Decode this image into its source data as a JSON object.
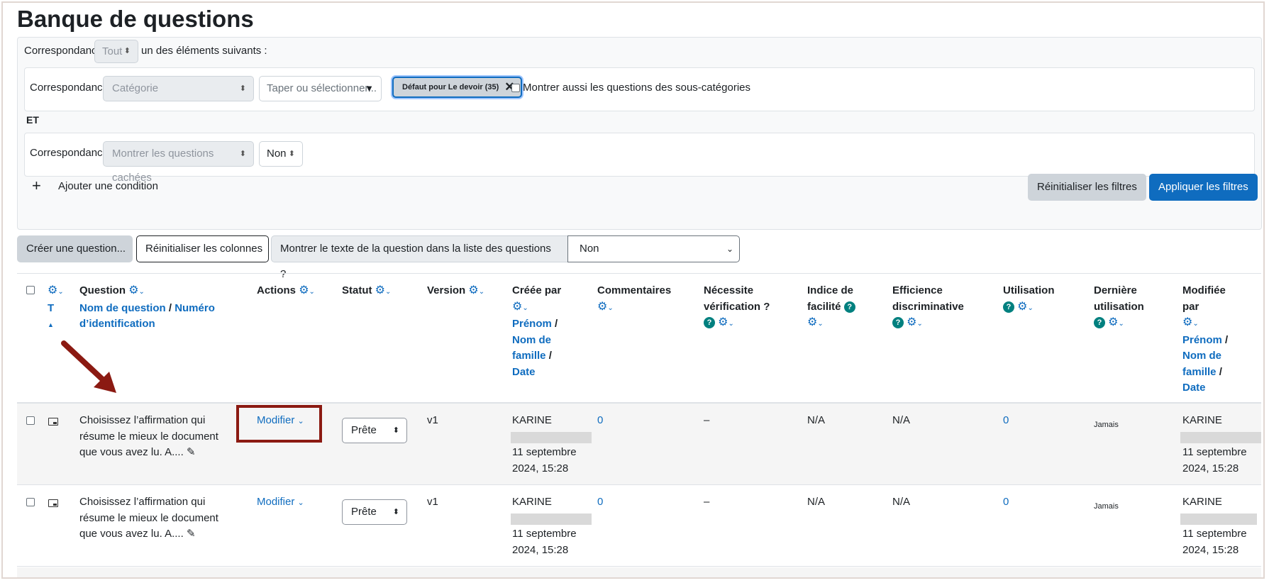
{
  "page_title": "Banque de questions",
  "filters": {
    "top_match_label": "Correspondance",
    "top_match_value": "Tout",
    "top_match_suffix": "un des éléments suivants :",
    "cond1": {
      "label": "Correspondance",
      "type_value": "Catégorie",
      "search_placeholder": "Taper ou sélectionner...",
      "chip_label": "Défaut pour Le devoir (35)",
      "chip_remove": "✕",
      "checkbox_label": "Montrer aussi les questions des sous-catégories"
    },
    "join_label": "ET",
    "cond2": {
      "label": "Correspondance",
      "type_value": "Montrer les questions cachées",
      "value": "Non"
    },
    "add_condition_icon": "+",
    "add_condition_label": "Ajouter une condition",
    "reset_label": "Réinitialiser les filtres",
    "apply_label": "Appliquer les filtres"
  },
  "toolbar": {
    "create_label": "Créer une question...",
    "reset_columns_label": "Réinitialiser les colonnes",
    "show_text_label": "Montrer le texte de la question dans la liste des questions ?",
    "show_text_value": "Non"
  },
  "table": {
    "headers": {
      "type": "T",
      "question": "Question",
      "question_name": "Nom de question",
      "question_sep": "/",
      "question_id_1": "Numéro",
      "question_id_2": "d’identification",
      "actions": "Actions",
      "status": "Statut",
      "version": "Version",
      "created_by": "Créée par",
      "firstname": "Prénom",
      "lastname_1": "Nom de",
      "lastname_2": "famille",
      "date": "Date",
      "comments": "Commentaires",
      "needs_check_1": "Nécessite",
      "needs_check_2": "vérification ?",
      "facility_1": "Indice de",
      "facility_2": "facilité",
      "discrim_1": "Efficience",
      "discrim_2": "discriminative",
      "usage": "Utilisation",
      "last_used_1": "Dernière",
      "last_used_2": "utilisation",
      "modified_by_1": "Modifiée",
      "modified_by_2": "par"
    },
    "rows": [
      {
        "question_1": "Choisissez l’affirmation qui",
        "question_2": "résume le mieux le document",
        "question_3": "que vous avez lu. A....",
        "action": "Modifier",
        "status": "Prête",
        "version": "v1",
        "created_name": "KARINE",
        "created_date_1": "11 septembre",
        "created_date_2": "2024, 15:28",
        "comments": "0",
        "needs_check": "–",
        "facility": "N/A",
        "discrimination": "N/A",
        "usage": "0",
        "last_used": "Jamais",
        "modified_name": "KARINE",
        "modified_date_1": "11 septembre",
        "modified_date_2": "2024, 15:28"
      },
      {
        "question_1": "Choisissez l’affirmation qui",
        "question_2": "résume le mieux le document",
        "question_3": "que vous avez lu. A....",
        "action": "Modifier",
        "status": "Prête",
        "version": "v1",
        "created_name": "KARINE",
        "created_date_1": "11 septembre",
        "created_date_2": "2024, 15:28",
        "comments": "0",
        "needs_check": "–",
        "facility": "N/A",
        "discrimination": "N/A",
        "usage": "0",
        "last_used": "Jamais",
        "modified_name": "KARINE",
        "modified_date_1": "11 septembre",
        "modified_date_2": "2024, 15:28"
      }
    ]
  },
  "icons": {
    "gear": "⚙",
    "caret": "⌄",
    "help": "?",
    "pencil": "✎",
    "sort_up": "▲",
    "dropdown": "▼",
    "updown": "⬍"
  },
  "colors": {
    "link": "#0f6cbf",
    "primary": "#0f6cbf",
    "highlight": "#8b1a12",
    "help": "#00807f"
  }
}
